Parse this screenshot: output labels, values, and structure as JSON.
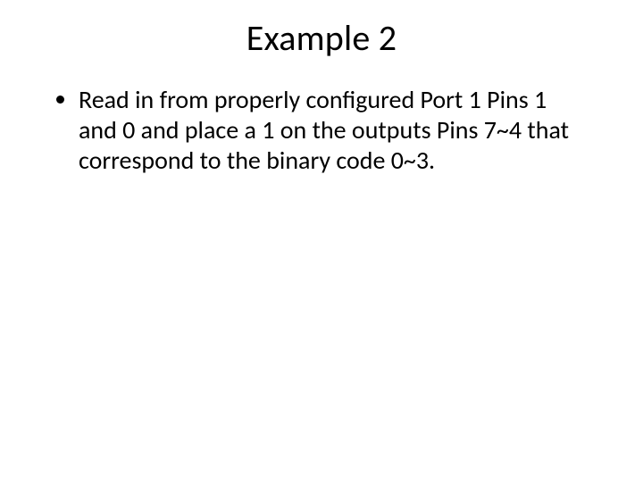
{
  "slide": {
    "title": "Example 2",
    "bullets": [
      "Read in from properly configured Port 1 Pins 1 and 0 and place a 1 on the outputs Pins 7~4 that correspond to the binary code 0~3."
    ]
  }
}
